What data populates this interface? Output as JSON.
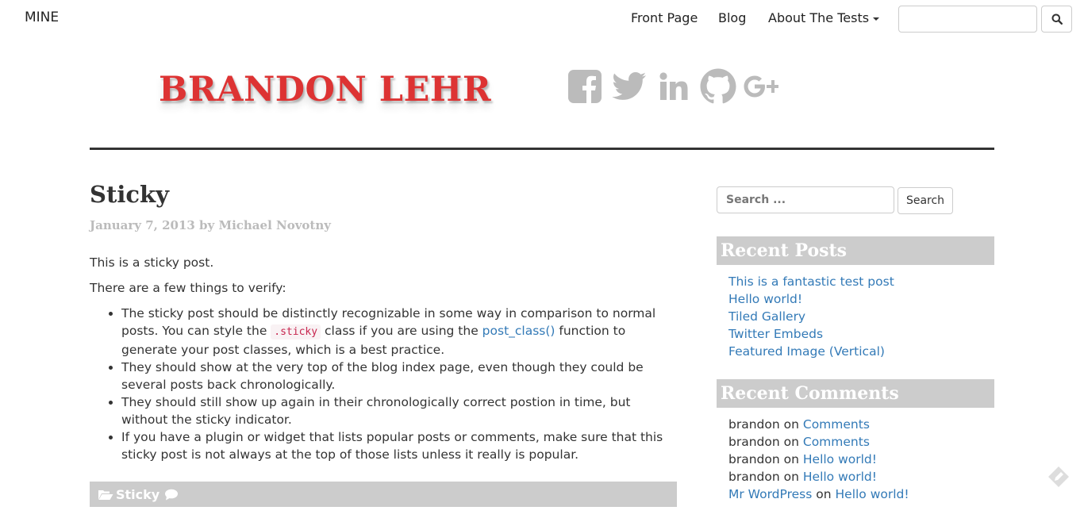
{
  "navbar": {
    "brand": "MINE",
    "links": [
      "Front Page",
      "Blog",
      "About The Tests"
    ],
    "search_value": ""
  },
  "header": {
    "site_title": "BRANDON LEHR",
    "social_icons": [
      "facebook-icon",
      "twitter-icon",
      "linkedin-icon",
      "github-icon",
      "google-plus-icon"
    ]
  },
  "post": {
    "title": "Sticky",
    "meta": "January 7, 2013 by Michael Novotny",
    "intro": "This is a sticky post.",
    "subintro": "There are a few things to verify:",
    "bullet1_a": "The sticky post should be distinctly recognizable in some way in comparison to normal posts. You can style the ",
    "bullet1_code": ".sticky",
    "bullet1_b": " class if you are using the ",
    "bullet1_link": "post_class()",
    "bullet1_c": " function to generate your post classes, which is a best practice.",
    "bullet2": "They should show at the very top of the blog index page, even though they could be several posts back chronologically.",
    "bullet3": "They should still show up again in their chronologically correct postion in time, but without the sticky indicator.",
    "bullet4": "If you have a plugin or widget that lists popular posts or comments, make sure that this sticky post is not always at the top of those lists unless it really is popular.",
    "footer_category": "Sticky"
  },
  "sidebar": {
    "search_placeholder": "Search ...",
    "search_button": "Search",
    "recent_posts_title": "Recent Posts",
    "recent_posts": [
      "This is a fantastic test post",
      "Hello world!",
      "Tiled Gallery",
      "Twitter Embeds",
      "Featured Image (Vertical)"
    ],
    "recent_comments_title": "Recent Comments",
    "recent_comments": [
      {
        "author": "brandon",
        "on": "on",
        "post": "Comments"
      },
      {
        "author": "brandon",
        "on": "on",
        "post": "Comments"
      },
      {
        "author": "brandon",
        "on": "on",
        "post": "Hello world!"
      },
      {
        "author": "brandon",
        "on": "on",
        "post": "Hello world!"
      },
      {
        "author": "Mr WordPress",
        "on": "on",
        "post": "Hello world!"
      }
    ]
  },
  "colors": {
    "title_red": "#dd3333",
    "link_blue": "#337ab7",
    "widget_gray": "#cccccc",
    "icon_gray": "#bbbbbb"
  }
}
